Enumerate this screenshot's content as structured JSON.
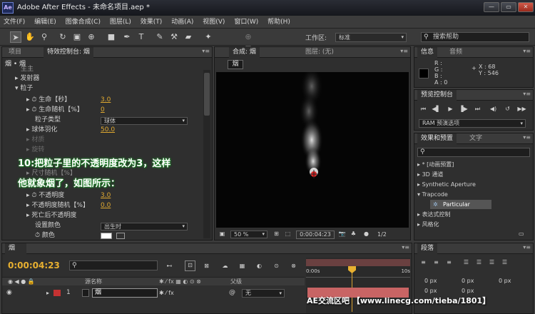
{
  "app": {
    "title": "Adobe After Effects - 未命名项目.aep *",
    "logo": "Ae"
  },
  "menu": [
    "文件(F)",
    "编辑(E)",
    "图像合成(C)",
    "图层(L)",
    "效果(T)",
    "动画(A)",
    "视图(V)",
    "窗口(W)",
    "帮助(H)"
  ],
  "toolbar": {
    "workspace_label": "工作区:",
    "workspace_value": "标准",
    "search_placeholder": "搜索帮助"
  },
  "effect_controls": {
    "tab_project": "项目",
    "tab_effects": "特效控制台: 烟",
    "header": "烟 • 烟",
    "rows": {
      "shengzhu": "生主",
      "emitter": "发射器",
      "particle": "粒子",
      "life": "生命【秒】",
      "life_val": "3.0",
      "life_random": "生命随机【%】",
      "life_random_val": "0",
      "particle_type": "粒子类型",
      "particle_type_val": "球体",
      "sphere_feather": "球体羽化",
      "sphere_feather_val": "50.0",
      "material": "材质",
      "rotation": "旋转",
      "size_random": "尺寸随机【%】",
      "opacity": "不透明度",
      "opacity_val": "3.0",
      "opacity_random": "不透明度随机【%】",
      "opacity_random_val": "0.0",
      "opacity_over_life": "死亡后不透明度",
      "set_color": "设置颜色",
      "set_color_val": "出生时",
      "color": "颜色"
    },
    "annotation_line1": "10:把粒子里的不透明度改为3，这样",
    "annotation_line2": "他就象烟了，如图所示："
  },
  "composition": {
    "tab_comp": "合成: 烟",
    "tab_layer": "图层: (无)",
    "comp_label": "烟",
    "zoom": "50 %",
    "timecode": "0:00:04:23",
    "resolution": "1/2"
  },
  "info": {
    "tab_info": "信息",
    "tab_audio": "音频",
    "r": "R :",
    "g": "G :",
    "b": "B :",
    "a": "A : 0",
    "x": "X : 68",
    "y": "Y : 546"
  },
  "preview": {
    "tab": "预览控制台",
    "ram": "RAM 预演选项"
  },
  "effects_presets": {
    "tab_effects": "效果和预置",
    "tab_text": "文字",
    "items": [
      "* [动画预置]",
      "3D 通道",
      "Synthetic Aperture",
      "Trapcode",
      "Particular",
      "表达式控制",
      "风格化"
    ]
  },
  "timeline": {
    "tab": "烟",
    "timecode": "0:00:04:23",
    "col_source": "源名称",
    "col_parent": "父级",
    "ruler_start": "0:00s",
    "ruler_end": "10s",
    "layer_num": "1",
    "layer_name": "烟",
    "parent_val": "无"
  },
  "paragraph": {
    "tab": "段落",
    "px": [
      "0 px",
      "0 px",
      "0 px",
      "0 px",
      "0 px"
    ]
  },
  "watermark": "AE交流区吧 【www.linecg.com/tieba/1801】",
  "colors": {
    "accent": "#e0a930",
    "timecode": "#e8b030",
    "layer_red": "#c43232",
    "work_area": "#c86464"
  }
}
